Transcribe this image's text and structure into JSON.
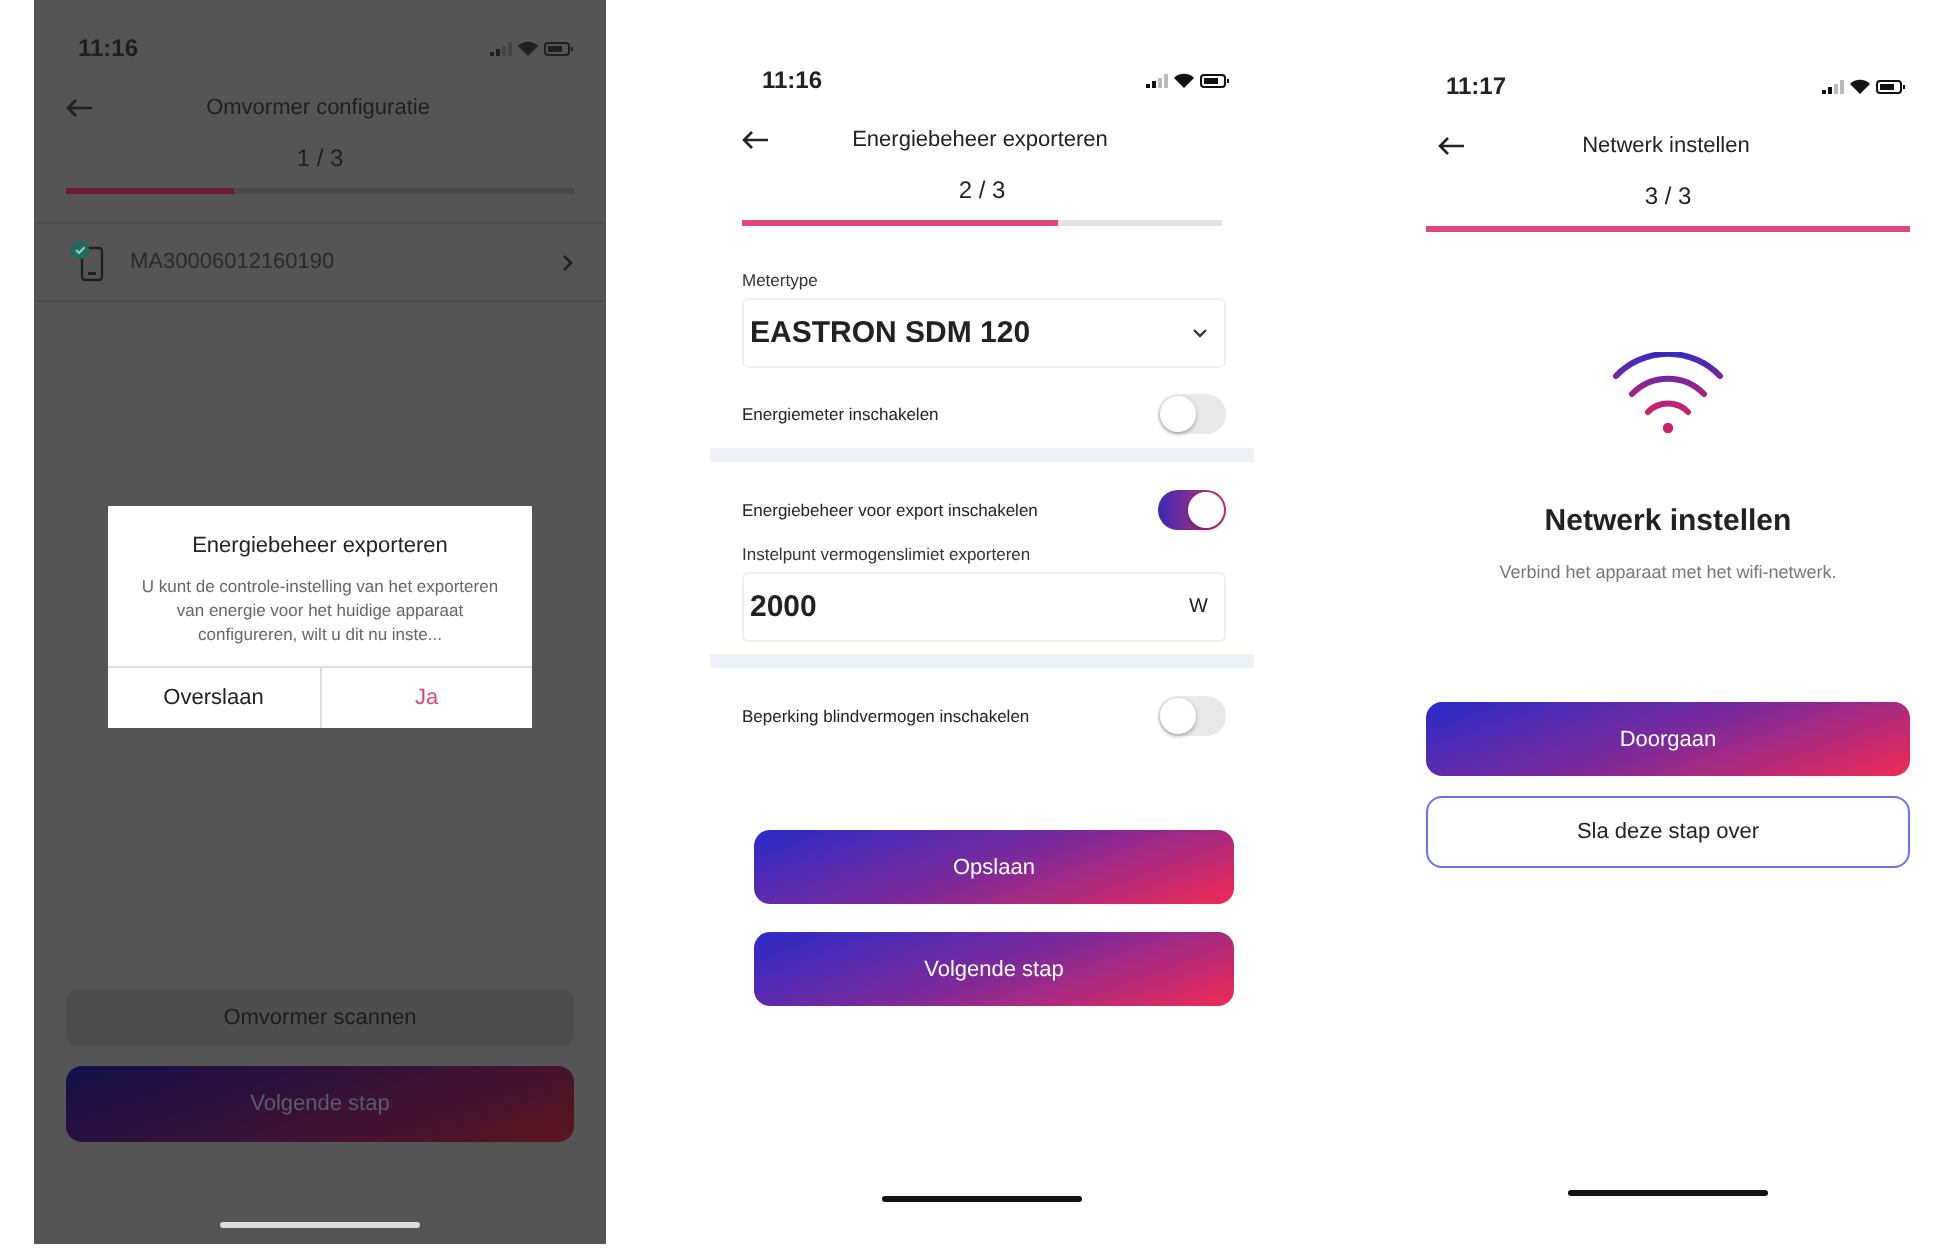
{
  "inverter_screen": {
    "time": "11:16",
    "title": "Omvormer configuratie",
    "step": "1 / 3",
    "progress": {
      "level": 0.33
    },
    "devices": [
      {
        "serial": "MA30006012160190",
        "connected": true
      }
    ],
    "buttons": [
      {
        "label": "Omvormer scannen",
        "kind": "secondary"
      },
      {
        "label": "Volgende stap",
        "kind": "primary"
      }
    ],
    "dialog": {
      "title": "Energiebeheer exporteren",
      "message": "U kunt de controle-instelling van het exporteren van energie voor het huidige apparaat configureren, wilt u dit nu inste...",
      "buttons": [
        {
          "label": "Overslaan",
          "kind": "cancel"
        },
        {
          "label": "Ja",
          "kind": "confirm"
        }
      ]
    }
  },
  "export_screen": {
    "time": "11:16",
    "title": "Energiebeheer exporteren",
    "step": "2 / 3",
    "progress": {
      "level": 0.66
    },
    "sections": [
      [
        {
          "kind": "select",
          "label": "Metertype",
          "value": "EASTRON SDM 120"
        },
        {
          "kind": "toggle",
          "label": "Energiemeter inschakelen",
          "on": false
        }
      ],
      [
        {
          "kind": "toggle",
          "label": "Energiebeheer voor export inschakelen",
          "on": true
        },
        {
          "kind": "input",
          "label": "Instelpunt vermogenslimiet exporteren",
          "value": "2000",
          "unit": "W"
        }
      ],
      [
        {
          "kind": "toggle",
          "label": "Beperking blindvermogen inschakelen",
          "on": false
        }
      ]
    ],
    "buttons": [
      {
        "label": "Opslaan",
        "kind": "primary"
      },
      {
        "label": "Volgende stap",
        "kind": "primary"
      }
    ]
  },
  "network_screen": {
    "time": "11:17",
    "title": "Netwerk instellen",
    "step": "3 / 3",
    "progress": {
      "level": 1
    },
    "heading": "Netwerk instellen",
    "description": "Verbind het apparaat met het wifi-netwerk.",
    "buttons": [
      {
        "label": "Doorgaan",
        "kind": "primary"
      },
      {
        "label": "Sla deze stap over",
        "kind": "outline"
      }
    ]
  }
}
